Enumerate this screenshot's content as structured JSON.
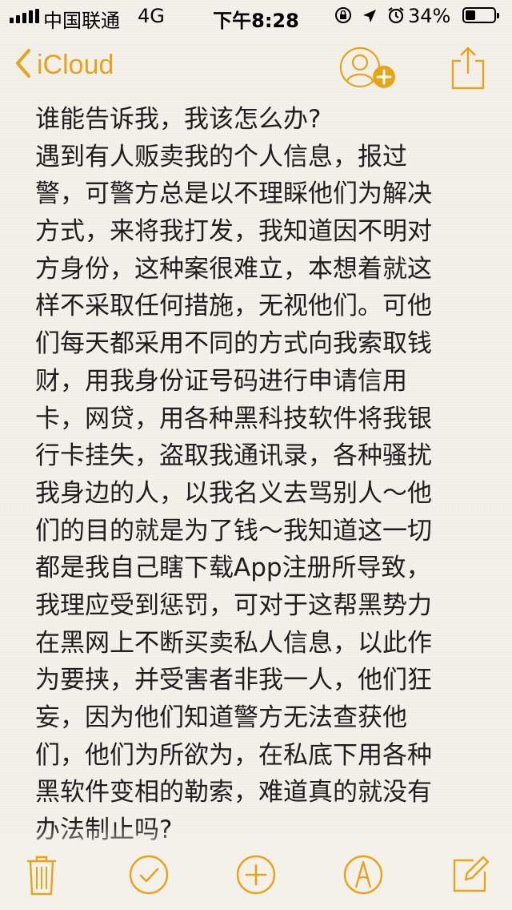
{
  "status_bar": {
    "carrier": "中国联通",
    "network": "4G",
    "time": "下午8:28",
    "battery_percent": "34%",
    "battery_level": 0.34,
    "icons": [
      "orientation-lock-icon",
      "location-icon",
      "alarm-icon"
    ]
  },
  "nav": {
    "back_label": "iCloud",
    "back_icon": "chevron-left-icon",
    "collaborate_icon": "add-person-icon",
    "share_icon": "share-icon"
  },
  "note": {
    "lines": [
      "谁能告诉我，我该怎么办?",
      "遇到有人贩卖我的个人信息，报过",
      "警，可警方总是以不理睬他们为解决",
      "方式，来将我打发，我知道因不明对",
      "方身份，这种案很难立，本想着就这",
      "样不采取任何措施，无视他们。可他",
      "们每天都采用不同的方式向我索取钱",
      "财，用我身份证号码进行申请信用",
      "卡，网贷，用各种黑科技软件将我银",
      "行卡挂失，盗取我通讯录，各种骚扰",
      "我身边的人，以我名义去骂别人～他",
      "们的目的就是为了钱～我知道这一切",
      "都是我自己瞎下载App注册所导致，",
      "我理应受到惩罚，可对于这帮黑势力",
      "在黑网上不断买卖私人信息，以此作",
      "为要挟，并受害者非我一人，他们狂",
      "妄，因为他们知道警方无法查获他",
      "们，他们为所欲为，在私底下用各种",
      "黑软件变相的勒索，难道真的就没有",
      "办法制止吗?"
    ]
  },
  "toolbar": {
    "icons": [
      "trash-icon",
      "checklist-icon",
      "add-icon",
      "markup-icon",
      "compose-icon"
    ]
  },
  "colors": {
    "accent": "#e6a419",
    "paper": "#f4f1ea",
    "text": "#1e1e1e"
  }
}
